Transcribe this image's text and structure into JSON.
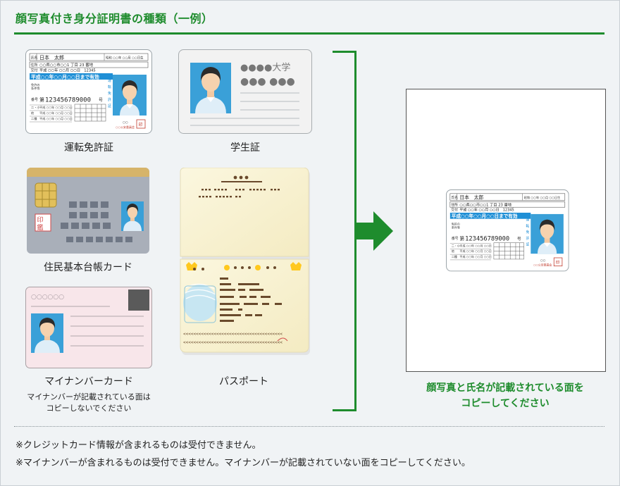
{
  "title": "顔写真付き身分証明書の種類（一例）",
  "license": {
    "label": "運転免許証",
    "name_tag": "氏名",
    "name": "日本　太郎",
    "birth": "昭和 ○○年 ○○月 ○○日生",
    "address_tag": "住所",
    "address": "○○県○○市○○1 丁目 23 番地",
    "issue_tag": "交付",
    "issue": "平成 ○○年 ○○月 ○○日　12345",
    "expiry": "平成○○年○○月○○日まで有効",
    "number_prefix": "第",
    "number": "123456789000",
    "number_suffix": "号",
    "side_text": "運転免許証",
    "issuer": "○○公安委員会",
    "seal": "印"
  },
  "student": {
    "label": "学生証",
    "univ": "●●●●大学",
    "name": "●●● ●●●"
  },
  "juki": {
    "label": "住民基本台帳カード",
    "seal": "印"
  },
  "mynumber": {
    "label": "マイナンバーカード",
    "note": "マイナンバーが記載されている面は\nコピーしないでください",
    "circles": "○○○○○○"
  },
  "passport": {
    "label": "パスポート",
    "mrz1": "<<<<<<<<<<<<<<<<<<<<<<<<<<<<<<<<<<<<<<<",
    "mrz2": "<<<<<<<<<<<<<<<<<<<<<<<<<<<<<<<<<<<<<<<"
  },
  "result_text": "顔写真と氏名が記載されている面を\nコピーしてください",
  "footnotes": [
    "※クレジットカード情報が含まれるものは受付できません。",
    "※マイナンバーが含まれるものは受付できません。マイナンバーが記載されていない面をコピーしてください。"
  ],
  "colors": {
    "brand_green": "#1e8c2d",
    "license_blue": "#1f8fd6",
    "photo_bg": "#3aa0d8"
  }
}
